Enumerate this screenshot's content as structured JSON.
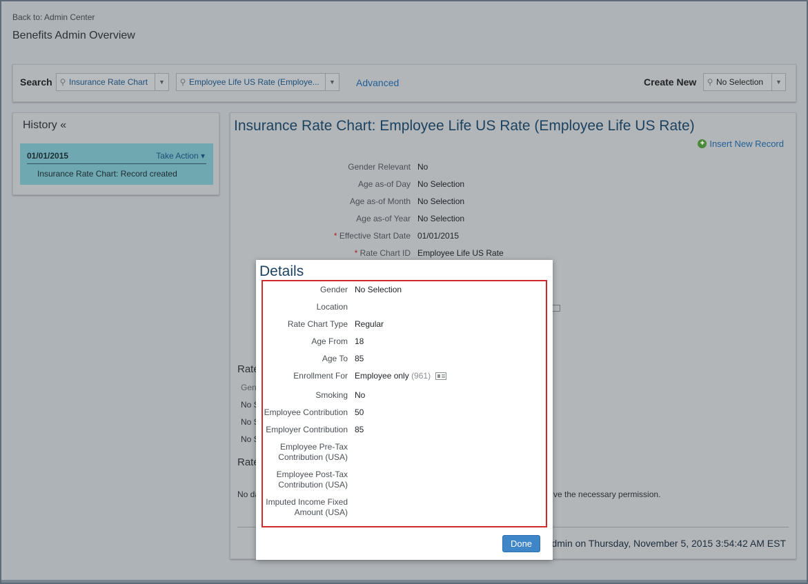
{
  "header": {
    "back_link": "Back to: Admin Center",
    "title": "Benefits Admin Overview"
  },
  "search": {
    "label": "Search",
    "type_value": "Insurance Rate Chart",
    "record_value": "Employee Life US Rate (Employe...",
    "advanced": "Advanced",
    "create_label": "Create New",
    "create_value": "No Selection"
  },
  "history": {
    "title": "History «",
    "entries": [
      {
        "date": "01/01/2015",
        "action": "Take Action ▾",
        "note": "Insurance Rate Chart: Record created"
      }
    ]
  },
  "main": {
    "title": "Insurance Rate Chart: Employee Life US Rate (Employee Life US Rate)",
    "insert_link": "Insert New Record",
    "fields": [
      {
        "label": "Gender Relevant",
        "value": "No",
        "required": false
      },
      {
        "label": "Age as-of Day",
        "value": "No Selection",
        "required": false
      },
      {
        "label": "Age as-of Month",
        "value": "No Selection",
        "required": false
      },
      {
        "label": "Age as-of Year",
        "value": "No Selection",
        "required": false
      },
      {
        "label": "Effective Start Date",
        "value": "01/01/2015",
        "required": true
      },
      {
        "label": "Rate Chart ID",
        "value": "Employee Life US Rate",
        "required": true
      }
    ],
    "required_marker": "*",
    "section1_partial": "Rate",
    "col_partial": "Gen",
    "row_partials": [
      "No S",
      "No S",
      "No S"
    ],
    "section2_partial": "Rate",
    "nodata_partial": "No da",
    "permission_partial": "ve the necessary permission.",
    "footer_partial": "dmin on Thursday, November 5, 2015 3:54:42 AM EST"
  },
  "dialog": {
    "title": "Details",
    "fields": [
      {
        "label": "Gender",
        "value": "No Selection"
      },
      {
        "label": "Location",
        "value": ""
      },
      {
        "label": "Rate Chart Type",
        "value": "Regular"
      },
      {
        "label": "Age From",
        "value": "18"
      },
      {
        "label": "Age To",
        "value": "85"
      },
      {
        "label": "Enrollment For",
        "value": "Employee only",
        "extra": "(961)"
      },
      {
        "label": "Smoking",
        "value": "No"
      },
      {
        "label": "Employee Contribution",
        "value": "50"
      },
      {
        "label": "Employer Contribution",
        "value": "85"
      },
      {
        "label": "Employee Pre-Tax",
        "label2": "Contribution (USA)",
        "value": ""
      },
      {
        "label": "Employee Post-Tax",
        "label2": "Contribution (USA)",
        "value": ""
      },
      {
        "label": "Imputed Income Fixed",
        "label2": "Amount (USA)",
        "value": ""
      }
    ],
    "done": "Done"
  },
  "colors": {
    "accent": "#3f86c8",
    "highlight_border": "#d22a2a",
    "title_blue": "#1c4260",
    "history_card": "#6fa8b0"
  }
}
